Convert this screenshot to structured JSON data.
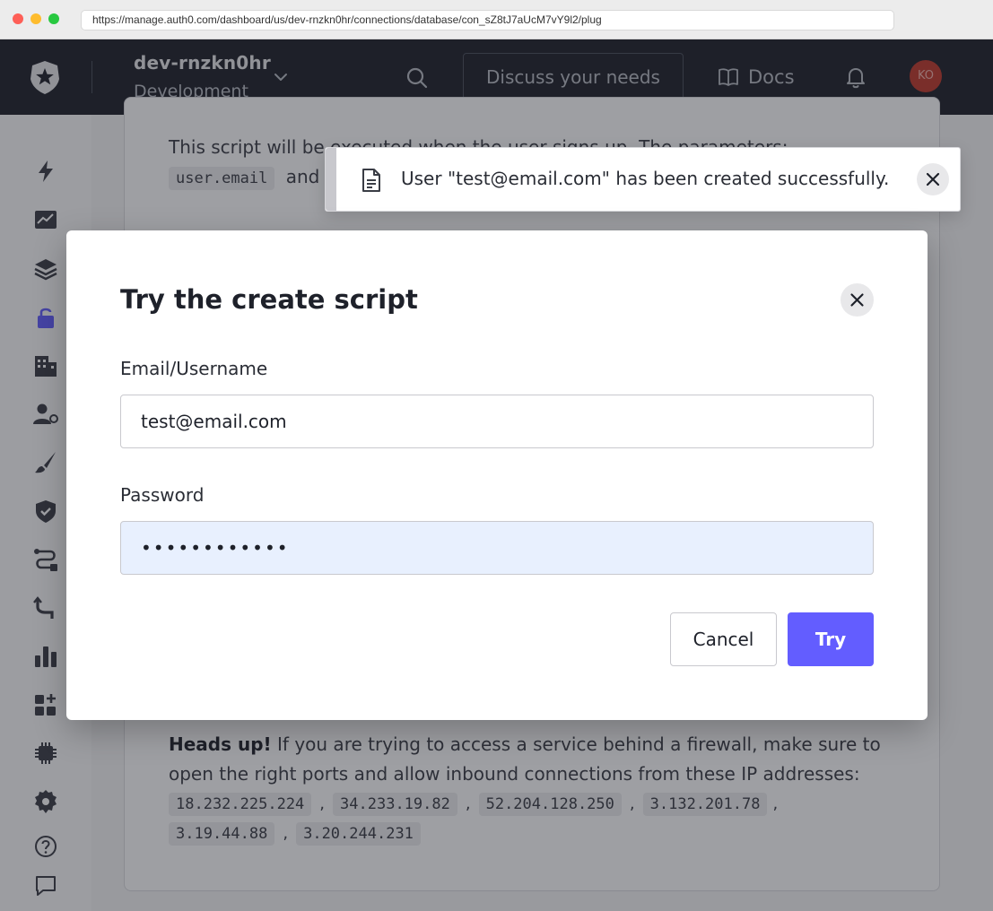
{
  "browser": {
    "url": "https://manage.auth0.com/dashboard/us/dev-rnzkn0hr/connections/database/con_sZ8tJ7aUcM7vY9l2/plug"
  },
  "header": {
    "tenant_name": "dev-rnzkn0hr",
    "tenant_env": "Development",
    "discuss_label": "Discuss your needs",
    "docs_label": "Docs",
    "avatar_initials": "KO"
  },
  "sidebar": {
    "items": [
      "activity-icon",
      "analytics-icon",
      "applications-icon",
      "authentication-icon",
      "organizations-icon",
      "user-management-icon",
      "branding-icon",
      "security-icon",
      "actions-icon",
      "auth-pipeline-icon",
      "monitoring-icon",
      "marketplace-icon",
      "extensions-icon",
      "settings-icon",
      "help-icon",
      "feedback-icon"
    ]
  },
  "background": {
    "desc_line1": "This script will be executed when the user signs up. The parameters:",
    "desc_code": "user.email",
    "desc_and": "and",
    "headsup_bold": "Heads up!",
    "headsup_text": " If you are trying to access a service behind a firewall, make sure to open the right ports and allow inbound connections from these IP addresses:",
    "ips": [
      "18.232.225.224",
      "34.233.19.82",
      "52.204.128.250",
      "3.132.201.78",
      "3.19.44.88",
      "3.20.244.231"
    ]
  },
  "toast": {
    "message": "User \"test@email.com\" has been created successfully."
  },
  "modal": {
    "title": "Try the create script",
    "email_label": "Email/Username",
    "email_value": "test@email.com",
    "password_label": "Password",
    "password_value": "••••••••••••",
    "cancel_label": "Cancel",
    "try_label": "Try"
  },
  "colors": {
    "header_bg": "#1e212a",
    "primary": "#635dff",
    "avatar_bg": "#c0392b",
    "autofill_bg": "#e8f0fe"
  }
}
